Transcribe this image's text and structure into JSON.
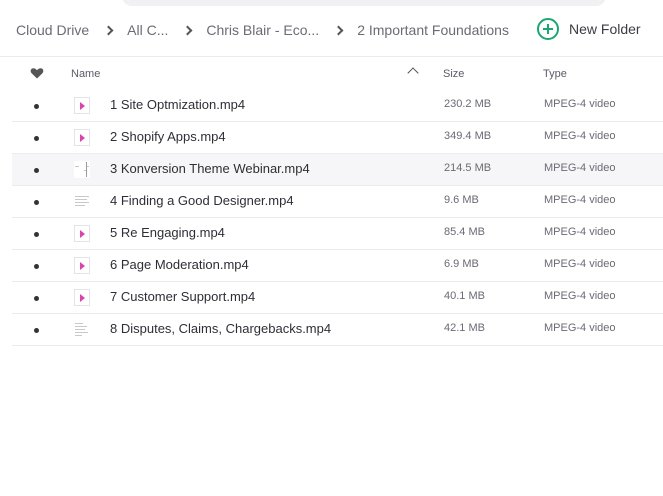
{
  "breadcrumb": {
    "items": [
      {
        "label": "Cloud Drive"
      },
      {
        "label": "All C..."
      },
      {
        "label": "Chris Blair - Eco..."
      },
      {
        "label": "2 Important Foundations"
      }
    ]
  },
  "toolbar": {
    "new_folder_label": "New Folder"
  },
  "columns": {
    "name": "Name",
    "size": "Size",
    "type": "Type"
  },
  "files": [
    {
      "name": "1 Site Optmization.mp4",
      "size": "230.2 MB",
      "type": "MPEG-4 video",
      "thumb": "play"
    },
    {
      "name": "2 Shopify Apps.mp4",
      "size": "349.4 MB",
      "type": "MPEG-4 video",
      "thumb": "play"
    },
    {
      "name": "3 Konversion Theme Webinar.mp4",
      "size": "214.5 MB",
      "type": "MPEG-4 video",
      "thumb": "doc"
    },
    {
      "name": "4 Finding a Good Designer.mp4",
      "size": "9.6 MB",
      "type": "MPEG-4 video",
      "thumb": "doc"
    },
    {
      "name": "5 Re Engaging.mp4",
      "size": "85.4 MB",
      "type": "MPEG-4 video",
      "thumb": "play"
    },
    {
      "name": "6 Page Moderation.mp4",
      "size": "6.9 MB",
      "type": "MPEG-4 video",
      "thumb": "play"
    },
    {
      "name": "7 Customer Support.mp4",
      "size": "40.1 MB",
      "type": "MPEG-4 video",
      "thumb": "play"
    },
    {
      "name": "8 Disputes, Claims, Chargebacks.mp4",
      "size": "42.1 MB",
      "type": "MPEG-4 video",
      "thumb": "doc"
    }
  ],
  "icons": {
    "favorite": "heart-icon",
    "sort": "chevron-up-icon",
    "new_folder": "plus-circle-icon",
    "video_thumb": "play-icon"
  },
  "colors": {
    "accent": "#1ba672",
    "play": "#d946a8"
  }
}
